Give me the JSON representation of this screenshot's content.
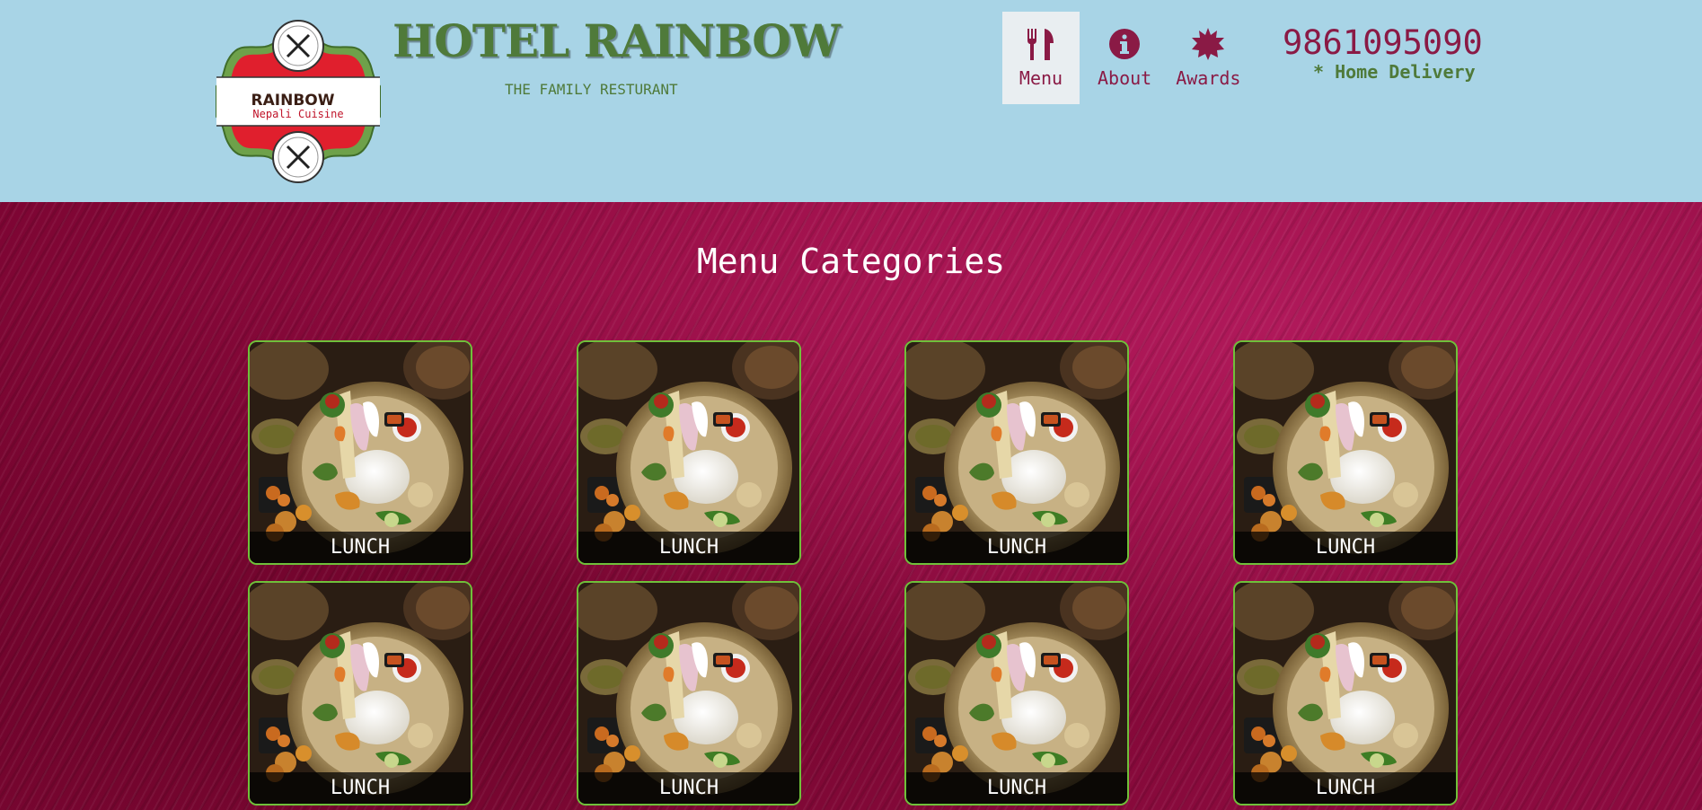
{
  "brand": {
    "logo_line1": "RAINBOW",
    "logo_line2": "Nepali Cuisine",
    "title": "HOTEL RAINBOW",
    "subtitle": "THE FAMILY RESTURANT"
  },
  "nav": {
    "items": [
      {
        "label": "Menu",
        "icon": "utensils-icon",
        "active": true
      },
      {
        "label": "About",
        "icon": "info-circle-icon",
        "active": false
      },
      {
        "label": "Awards",
        "icon": "award-seal-icon",
        "active": false
      }
    ]
  },
  "contact": {
    "phone": "9861095090",
    "delivery": "* Home Delivery"
  },
  "colors": {
    "header_bg": "#a8d4e6",
    "brand_green": "#4f7a3a",
    "accent_maroon": "#8a1a45",
    "card_border": "#6fc03a"
  },
  "menu": {
    "title": "Menu Categories",
    "categories": [
      {
        "label": "LUNCH"
      },
      {
        "label": "LUNCH"
      },
      {
        "label": "LUNCH"
      },
      {
        "label": "LUNCH"
      },
      {
        "label": "LUNCH"
      },
      {
        "label": "LUNCH"
      },
      {
        "label": "LUNCH"
      },
      {
        "label": "LUNCH"
      }
    ]
  }
}
